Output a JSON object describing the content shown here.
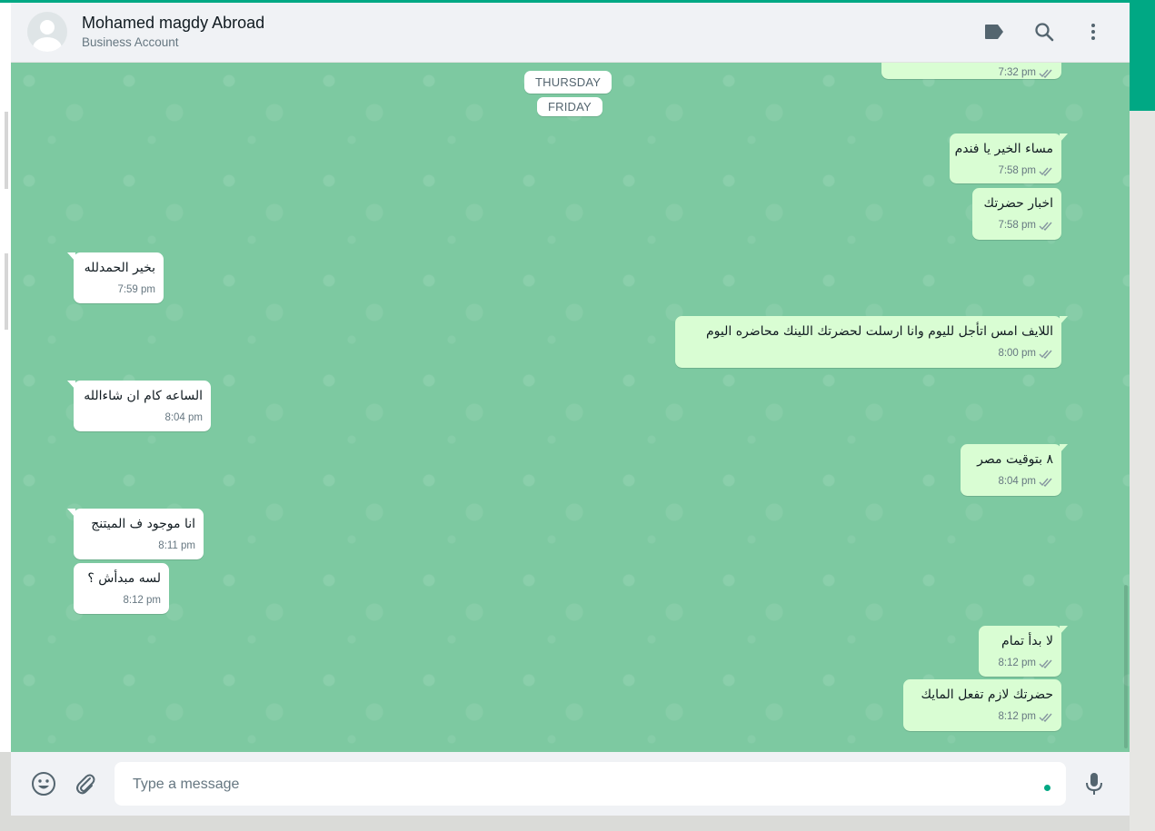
{
  "header": {
    "contact_name": "Mohamed magdy Abroad",
    "contact_subtitle": "Business Account"
  },
  "date_chips": [
    "THURSDAY",
    "FRIDAY"
  ],
  "messages": [
    {
      "dir": "out",
      "text": "",
      "time": "7:32 pm",
      "read": true
    },
    {
      "dir": "out",
      "text": "مساء الخير يا فندم",
      "time": "7:58 pm",
      "read": true
    },
    {
      "dir": "out",
      "text": "اخبار حضرتك",
      "time": "7:58 pm",
      "read": true
    },
    {
      "dir": "in",
      "text": "بخير الحمدلله",
      "time": "7:59 pm"
    },
    {
      "dir": "out",
      "text": "اللايف امس اتأجل لليوم وانا ارسلت لحضرتك اللينك محاضره اليوم",
      "time": "8:00 pm",
      "read": true
    },
    {
      "dir": "in",
      "text": "الساعه كام ان شاءالله",
      "time": "8:04 pm"
    },
    {
      "dir": "out",
      "text": "٨ بتوقيت مصر",
      "time": "8:04 pm",
      "read": true
    },
    {
      "dir": "in",
      "text": "انا موجود ف الميتنج",
      "time": "8:11 pm"
    },
    {
      "dir": "in",
      "text": "لسه مبدأش ؟",
      "time": "8:12 pm"
    },
    {
      "dir": "out",
      "text": "لا بدأ تمام",
      "time": "8:12 pm",
      "read": true
    },
    {
      "dir": "out",
      "text": "حضرتك لازم تفعل المايك",
      "time": "8:12 pm",
      "read": true
    }
  ],
  "composer": {
    "placeholder": "Type a message"
  },
  "colors": {
    "accent": "#00a884",
    "chat_background": "#7dc9a1",
    "outgoing_bubble": "#d9fdd3",
    "incoming_bubble": "#ffffff",
    "read_ticks": "#8696a0"
  },
  "icons": {
    "header": [
      "label-icon",
      "search-icon",
      "more-vertical-icon"
    ],
    "footer": [
      "emoji-icon",
      "attach-icon",
      "microphone-icon"
    ]
  }
}
